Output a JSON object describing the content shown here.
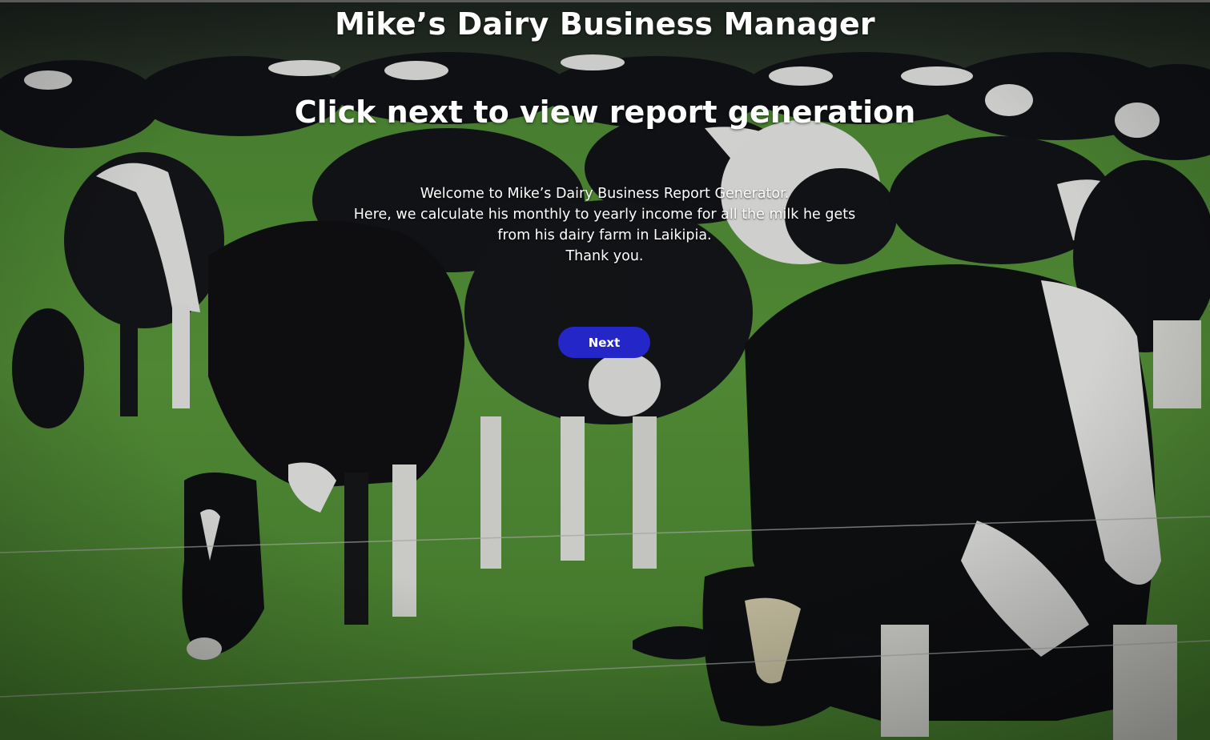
{
  "header": {
    "title": "Mike’s Dairy Business Manager"
  },
  "main": {
    "subtitle": "Click next to view report generation",
    "welcome_lines": [
      "Welcome to Mike’s Dairy Business Report Generator.",
      "Here, we calculate his monthly to yearly income for all the milk he gets",
      "from his dairy farm in Laikipia.",
      "Thank you."
    ],
    "next_label": "Next"
  },
  "colors": {
    "button": "#2426c8",
    "text": "#ffffff",
    "grass": "#4f8a34"
  },
  "background": {
    "icon": "grazing-cows-photo"
  }
}
